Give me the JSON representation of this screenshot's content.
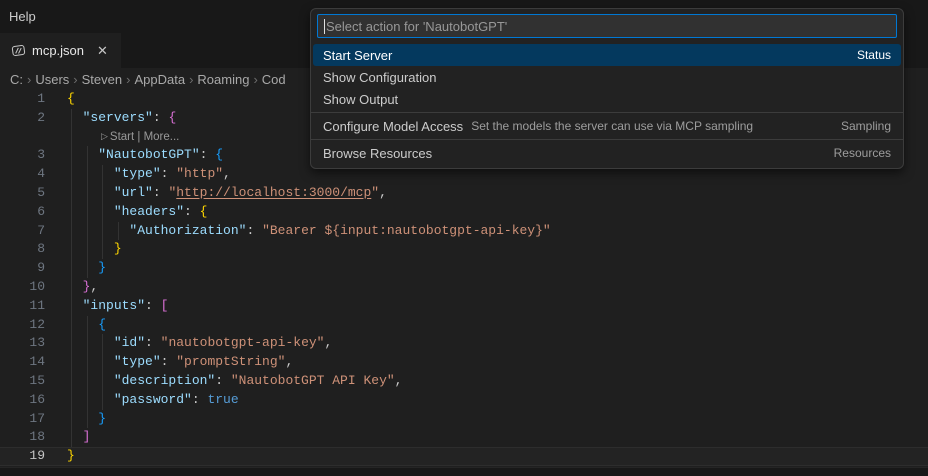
{
  "menu": {
    "help": "Help"
  },
  "tab": {
    "name": "mcp.json",
    "close_glyph": "✕"
  },
  "breadcrumb": {
    "separator": "›",
    "items": [
      "C:",
      "Users",
      "Steven",
      "AppData",
      "Roaming",
      "Cod"
    ]
  },
  "quickpick": {
    "placeholder": "Select action for 'NautobotGPT'",
    "items": [
      {
        "label": "Start Server",
        "description": "",
        "badge": "Status",
        "selected": true,
        "separator_above": false
      },
      {
        "label": "Show Configuration",
        "description": "",
        "badge": "",
        "selected": false,
        "separator_above": false
      },
      {
        "label": "Show Output",
        "description": "",
        "badge": "",
        "selected": false,
        "separator_above": false
      },
      {
        "label": "Configure Model Access",
        "description": "Set the models the server can use via MCP sampling",
        "badge": "Sampling",
        "selected": false,
        "separator_above": true
      },
      {
        "label": "Browse Resources",
        "description": "",
        "badge": "Resources",
        "selected": false,
        "separator_above": true
      }
    ]
  },
  "editor": {
    "codelens": {
      "icon": "▷",
      "text": "Start | More..."
    },
    "rows": [
      {
        "num": 1,
        "guides": 0,
        "segs": [
          [
            "b1",
            "{"
          ]
        ]
      },
      {
        "num": 2,
        "guides": 1,
        "segs": [
          [
            "pln",
            "  "
          ],
          [
            "key",
            "\"servers\""
          ],
          [
            "pun",
            ": "
          ],
          [
            "b2",
            "{"
          ]
        ]
      },
      {
        "type": "codelens",
        "guides": 1
      },
      {
        "num": 3,
        "guides": 2,
        "segs": [
          [
            "pln",
            "    "
          ],
          [
            "key",
            "\"NautobotGPT\""
          ],
          [
            "pun",
            ": "
          ],
          [
            "b3",
            "{"
          ]
        ]
      },
      {
        "num": 4,
        "guides": 3,
        "segs": [
          [
            "pln",
            "      "
          ],
          [
            "key",
            "\"type\""
          ],
          [
            "pun",
            ": "
          ],
          [
            "str",
            "\"http\""
          ],
          [
            "pun",
            ","
          ]
        ]
      },
      {
        "num": 5,
        "guides": 3,
        "segs": [
          [
            "pln",
            "      "
          ],
          [
            "key",
            "\"url\""
          ],
          [
            "pun",
            ": "
          ],
          [
            "str",
            "\""
          ],
          [
            "url",
            "http://localhost:3000/mcp"
          ],
          [
            "str",
            "\""
          ],
          [
            "pun",
            ","
          ]
        ]
      },
      {
        "num": 6,
        "guides": 3,
        "segs": [
          [
            "pln",
            "      "
          ],
          [
            "key",
            "\"headers\""
          ],
          [
            "pun",
            ": "
          ],
          [
            "b1",
            "{"
          ]
        ]
      },
      {
        "num": 7,
        "guides": 4,
        "segs": [
          [
            "pln",
            "        "
          ],
          [
            "key",
            "\"Authorization\""
          ],
          [
            "pun",
            ": "
          ],
          [
            "str",
            "\"Bearer ${input:nautobotgpt-api-key}\""
          ]
        ]
      },
      {
        "num": 8,
        "guides": 3,
        "segs": [
          [
            "pln",
            "      "
          ],
          [
            "b1",
            "}"
          ]
        ]
      },
      {
        "num": 9,
        "guides": 2,
        "segs": [
          [
            "pln",
            "    "
          ],
          [
            "b3",
            "}"
          ]
        ]
      },
      {
        "num": 10,
        "guides": 1,
        "segs": [
          [
            "pln",
            "  "
          ],
          [
            "b2",
            "}"
          ],
          [
            "pun",
            ","
          ]
        ]
      },
      {
        "num": 11,
        "guides": 1,
        "segs": [
          [
            "pln",
            "  "
          ],
          [
            "key",
            "\"inputs\""
          ],
          [
            "pun",
            ": "
          ],
          [
            "b2",
            "["
          ]
        ]
      },
      {
        "num": 12,
        "guides": 2,
        "segs": [
          [
            "pln",
            "    "
          ],
          [
            "b3",
            "{"
          ]
        ]
      },
      {
        "num": 13,
        "guides": 3,
        "segs": [
          [
            "pln",
            "      "
          ],
          [
            "key",
            "\"id\""
          ],
          [
            "pun",
            ": "
          ],
          [
            "str",
            "\"nautobotgpt-api-key\""
          ],
          [
            "pun",
            ","
          ]
        ]
      },
      {
        "num": 14,
        "guides": 3,
        "segs": [
          [
            "pln",
            "      "
          ],
          [
            "key",
            "\"type\""
          ],
          [
            "pun",
            ": "
          ],
          [
            "str",
            "\"promptString\""
          ],
          [
            "pun",
            ","
          ]
        ]
      },
      {
        "num": 15,
        "guides": 3,
        "segs": [
          [
            "pln",
            "      "
          ],
          [
            "key",
            "\"description\""
          ],
          [
            "pun",
            ": "
          ],
          [
            "str",
            "\"NautobotGPT API Key\""
          ],
          [
            "pun",
            ","
          ]
        ]
      },
      {
        "num": 16,
        "guides": 3,
        "segs": [
          [
            "pln",
            "      "
          ],
          [
            "key",
            "\"password\""
          ],
          [
            "pun",
            ": "
          ],
          [
            "kw",
            "true"
          ]
        ]
      },
      {
        "num": 17,
        "guides": 2,
        "segs": [
          [
            "pln",
            "    "
          ],
          [
            "b3",
            "}"
          ]
        ]
      },
      {
        "num": 18,
        "guides": 1,
        "segs": [
          [
            "pln",
            "  "
          ],
          [
            "b2",
            "]"
          ]
        ]
      },
      {
        "num": 19,
        "guides": 0,
        "active": true,
        "segs": [
          [
            "b1",
            "}"
          ]
        ]
      }
    ]
  },
  "colors": {
    "editor_background": "#1f1f1f",
    "chrome_background": "#181818",
    "focus_border": "#0078d4",
    "list_selection_background": "#04395e",
    "json_key": "#9cdcfe",
    "json_string": "#ce9178",
    "json_keyword": "#569cd6",
    "bracket_level_1": "#ffd700",
    "bracket_level_2": "#da70d6",
    "bracket_level_3": "#179fff"
  }
}
